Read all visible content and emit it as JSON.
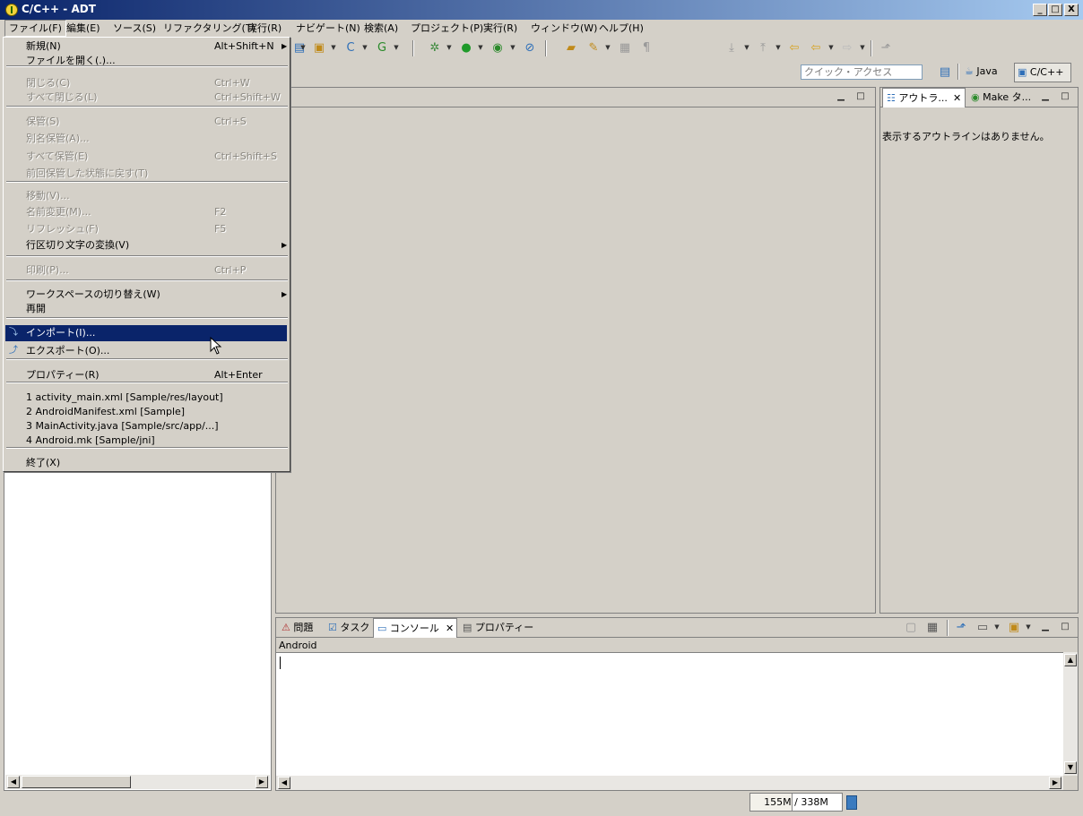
{
  "window": {
    "title": "C/C++ - ADT",
    "min": "_",
    "max": "□",
    "close": "X"
  },
  "menubar": [
    "ファイル(F)",
    "編集(E)",
    "ソース(S)",
    "リファクタリング(T)",
    "実行(R)",
    "ナビゲート(N)",
    "検索(A)",
    "プロジェクト(P)",
    "実行(R)",
    "ウィンドウ(W)",
    "ヘルプ(H)"
  ],
  "quick_access": {
    "placeholder": "クイック・アクセス"
  },
  "perspectives": {
    "java": "Java",
    "cpp": "C/C++"
  },
  "outline_panel": {
    "tab_outline": "アウトラ...",
    "tab_make": "Make タ...",
    "message": "表示するアウトラインはありません。"
  },
  "bottom_panel": {
    "tabs": [
      "問題",
      "タスク",
      "コンソール",
      "プロパティー"
    ],
    "console_name": "Android"
  },
  "status": {
    "heap": "155M / 338M",
    "heap_used_fraction": 0.46
  },
  "file_menu": {
    "items": [
      {
        "label": "新規(N)",
        "accel": "Alt+Shift+N",
        "submenu": true,
        "disabled": false
      },
      {
        "label": "ファイルを開く(.)...",
        "accel": "",
        "disabled": false
      },
      {
        "label": "閉じる(C)",
        "accel": "Ctrl+W",
        "disabled": true
      },
      {
        "label": "すべて閉じる(L)",
        "accel": "Ctrl+Shift+W",
        "disabled": true
      },
      {
        "label": "保管(S)",
        "accel": "Ctrl+S",
        "disabled": true
      },
      {
        "label": "別名保管(A)...",
        "accel": "",
        "disabled": true
      },
      {
        "label": "すべて保管(E)",
        "accel": "Ctrl+Shift+S",
        "disabled": true
      },
      {
        "label": "前回保管した状態に戻す(T)",
        "accel": "",
        "disabled": true
      },
      {
        "label": "移動(V)...",
        "accel": "",
        "disabled": true
      },
      {
        "label": "名前変更(M)...",
        "accel": "F2",
        "disabled": true
      },
      {
        "label": "リフレッシュ(F)",
        "accel": "F5",
        "disabled": true
      },
      {
        "label": "行区切り文字の変換(V)",
        "accel": "",
        "submenu": true,
        "disabled": false
      },
      {
        "label": "印刷(P)...",
        "accel": "Ctrl+P",
        "disabled": true
      },
      {
        "label": "ワークスペースの切り替え(W)",
        "accel": "",
        "submenu": true,
        "disabled": false
      },
      {
        "label": "再開",
        "accel": "",
        "disabled": false
      },
      {
        "label": "インポート(I)...",
        "accel": "",
        "disabled": false,
        "highlighted": true
      },
      {
        "label": "エクスポート(O)...",
        "accel": "",
        "disabled": false
      },
      {
        "label": "プロパティー(R)",
        "accel": "Alt+Enter",
        "disabled": false
      },
      {
        "label": "1 activity_main.xml  [Sample/res/layout]",
        "accel": "",
        "disabled": false
      },
      {
        "label": "2 AndroidManifest.xml  [Sample]",
        "accel": "",
        "disabled": false
      },
      {
        "label": "3 MainActivity.java  [Sample/src/app/...]",
        "accel": "",
        "disabled": false
      },
      {
        "label": "4 Android.mk  [Sample/jni]",
        "accel": "",
        "disabled": false
      },
      {
        "label": "終了(X)",
        "accel": "",
        "disabled": false
      }
    ]
  }
}
